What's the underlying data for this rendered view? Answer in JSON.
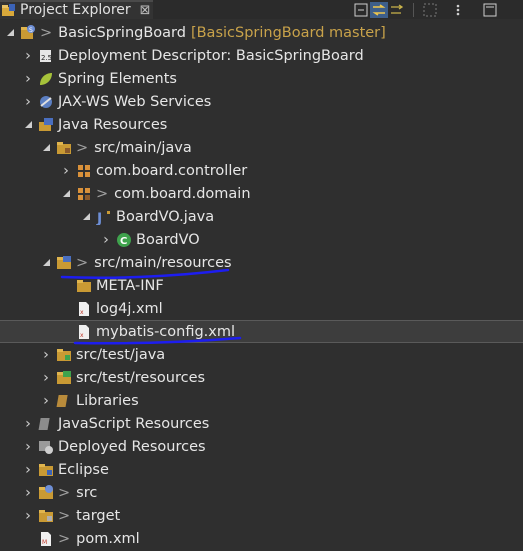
{
  "view": {
    "title": "Project Explorer",
    "close_glyph": "⊠",
    "toolbar": [
      "collapse-all-icon",
      "link-with-editor-icon",
      "filters-icon",
      "focus-icon",
      "view-menu-icon",
      "minimize-icon"
    ]
  },
  "tree": {
    "project": {
      "prefix": ">",
      "label": "BasicSpringBoard",
      "decoration": "[BasicSpringBoard master]"
    },
    "deployment": "Deployment Descriptor: BasicSpringBoard",
    "spring": "Spring Elements",
    "jaxws": "JAX-WS Web Services",
    "java_resources": "Java Resources",
    "src_main_java": {
      "prefix": ">",
      "label": "src/main/java"
    },
    "pkg_controller": "com.board.controller",
    "pkg_domain": {
      "prefix": ">",
      "label": "com.board.domain"
    },
    "boardvo_java": "BoardVO.java",
    "boardvo_class": "BoardVO",
    "src_main_resources": {
      "prefix": ">",
      "label": "src/main/resources"
    },
    "meta_inf": "META-INF",
    "log4j": "log4j.xml",
    "mybatis": "mybatis-config.xml",
    "src_test_java": "src/test/java",
    "src_test_resources": "src/test/resources",
    "libraries": "Libraries",
    "js_resources": "JavaScript Resources",
    "deployed_resources": "Deployed Resources",
    "eclipse": "Eclipse",
    "src": {
      "prefix": ">",
      "label": "src"
    },
    "target": {
      "prefix": ">",
      "label": "target"
    },
    "pom": {
      "prefix": ">",
      "label": "pom.xml"
    }
  },
  "colors": {
    "background": "#2f2f2f",
    "annotation": "#1d1df0",
    "decoration": "#c8a24a"
  }
}
